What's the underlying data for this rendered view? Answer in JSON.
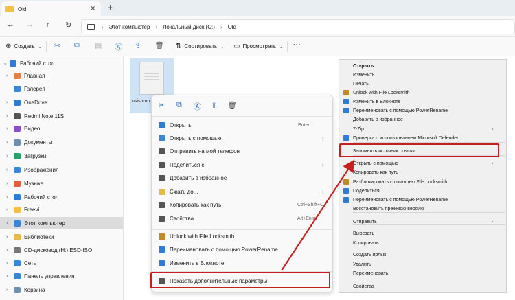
{
  "window": {
    "tab_title": "Old"
  },
  "address": {
    "crumbs": [
      "Этот компьютер",
      "Локальный диск (C:)",
      "Old"
    ]
  },
  "toolbar": {
    "create_label": "Создать",
    "sort_label": "Сортировать",
    "view_label": "Просмотреть"
  },
  "sidebar": {
    "items": [
      {
        "label": "Рабочий стол",
        "icon": "desktop-icon",
        "color": "#2f7bd6"
      },
      {
        "label": "Главная",
        "icon": "home-icon",
        "color": "#e0824a"
      },
      {
        "label": "Галерея",
        "icon": "gallery-icon",
        "color": "#3b86d4"
      },
      {
        "label": "OneDrive",
        "icon": "cloud-icon",
        "color": "#2f7bd6"
      },
      {
        "label": "Redmi Note 11S",
        "icon": "phone-icon",
        "color": "#555555"
      },
      {
        "label": "Видео",
        "icon": "video-icon",
        "color": "#8a4cc8"
      },
      {
        "label": "Документы",
        "icon": "documents-icon",
        "color": "#6e8fb0"
      },
      {
        "label": "Загрузки",
        "icon": "downloads-icon",
        "color": "#2aa36a"
      },
      {
        "label": "Изображения",
        "icon": "pictures-icon",
        "color": "#3b86d4"
      },
      {
        "label": "Музыка",
        "icon": "music-icon",
        "color": "#e45d3a"
      },
      {
        "label": "Рабочий стол",
        "icon": "desktop-icon",
        "color": "#2f7bd6"
      },
      {
        "label": "Freevi",
        "icon": "folder-icon",
        "color": "#f4c145"
      },
      {
        "label": "Этот компьютер",
        "icon": "computer-icon",
        "color": "#3b86d4"
      },
      {
        "label": "Библиотеки",
        "icon": "libraries-icon",
        "color": "#e7b84a"
      },
      {
        "label": "CD-дисковод (H:) ESD-ISO",
        "icon": "cd-drive-icon",
        "color": "#777777"
      },
      {
        "label": "Сеть",
        "icon": "network-icon",
        "color": "#3b86d4"
      },
      {
        "label": "Панель управления",
        "icon": "control-panel-icon",
        "color": "#3b86d4"
      },
      {
        "label": "Корзина",
        "icon": "recycle-bin-icon",
        "color": "#6e8fb0"
      }
    ]
  },
  "file": {
    "name_line1": "nsispron",
    "name_line2": "g"
  },
  "menu1": {
    "items": [
      {
        "label": "Открыть",
        "shortcut": "Enter",
        "color": "#2f7bd6"
      },
      {
        "label": "Открыть с помощью",
        "shortcut": "",
        "color": "#3b86d4",
        "arrow": "›"
      },
      {
        "label": "Отправить на мой телефон",
        "shortcut": "",
        "color": "#555555"
      },
      {
        "label": "Поделиться с",
        "shortcut": "",
        "color": "#555555",
        "arrow": "›"
      },
      {
        "label": "Добавить в избранное",
        "shortcut": "",
        "color": "#555555"
      },
      {
        "label": "Сжать до...",
        "shortcut": "",
        "color": "#e7b84a",
        "arrow": "›"
      },
      {
        "label": "Копировать как путь",
        "shortcut": "Ctrl+Shift+C",
        "color": "#555555"
      },
      {
        "label": "Свойства",
        "shortcut": "Alt+Enter",
        "color": "#555555"
      },
      {
        "label": "Unlock with File Locksmith",
        "shortcut": "",
        "color": "#c08a2a"
      },
      {
        "label": "Переименовать с помощью PowerRename",
        "shortcut": "",
        "color": "#2f7bd6"
      },
      {
        "label": "Изменить в Блокноте",
        "shortcut": "",
        "color": "#2f7bd6"
      },
      {
        "label": "Показать дополнительные параметры",
        "shortcut": "",
        "color": "#555555"
      }
    ]
  },
  "menu2": {
    "items": [
      {
        "label": "Открыть",
        "bold": true
      },
      {
        "label": "Изменить"
      },
      {
        "label": "Печать"
      },
      {
        "label": "Unlock with File Locksmith",
        "color": "#c08a2a"
      },
      {
        "label": "Изменить в Блокноте",
        "color": "#2f7bd6"
      },
      {
        "label": "Переименовать с помощью PowerRename",
        "color": "#2f7bd6"
      },
      {
        "label": "Добавить в избранное"
      },
      {
        "label": "7-Zip",
        "arrow": "›"
      },
      {
        "label": "Проверка с использованием Microsoft Defender...",
        "color": "#2f7bd6"
      },
      {
        "label": "Запомнить источник ссылки"
      },
      {
        "label": "Открыть с помощью",
        "arrow": "›"
      },
      {
        "label": "Копировать как путь"
      },
      {
        "label": "Разблокировать с помощью File Locksmith",
        "color": "#c08a2a"
      },
      {
        "label": "Поделиться",
        "color": "#2f7bd6"
      },
      {
        "label": "Переименовать с помощью PowerRename",
        "color": "#2f7bd6"
      },
      {
        "label": "Восстановить прежнюю версию"
      },
      {
        "label": "Отправить",
        "arrow": "›"
      },
      {
        "label": "Вырезать"
      },
      {
        "label": "Копировать"
      },
      {
        "label": "Создать ярлык"
      },
      {
        "label": "Удалить"
      },
      {
        "label": "Переименовать"
      },
      {
        "label": "Свойства"
      }
    ]
  }
}
